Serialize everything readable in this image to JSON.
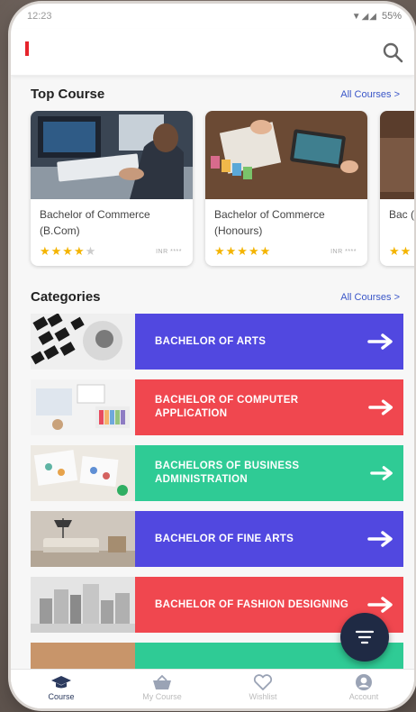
{
  "status_bar": {
    "time": "12:23",
    "battery": "55%"
  },
  "top_course": {
    "title": "Top Course",
    "link": "All Courses >",
    "courses": [
      {
        "name": "Bachelor of Commerce (B.Com)",
        "rating": 4,
        "price": "INR ****"
      },
      {
        "name": "Bachelor of Commerce (Honours)",
        "rating": 5,
        "price": "INR ****"
      },
      {
        "name": "Bac (Ho",
        "rating": 2,
        "price": ""
      }
    ]
  },
  "categories": {
    "title": "Categories",
    "link": "All Courses >",
    "items": [
      {
        "label": "BACHELOR OF ARTS",
        "color": "#5148e0"
      },
      {
        "label": "BACHELOR OF COMPUTER APPLICATION",
        "color": "#f0474f"
      },
      {
        "label": "BACHELORS OF BUSINESS ADMINISTRATION",
        "color": "#2fcb95"
      },
      {
        "label": "BACHELOR OF FINE ARTS",
        "color": "#5148e0"
      },
      {
        "label": "BACHELOR OF FASHION DESIGNING",
        "color": "#f0474f"
      },
      {
        "label": "",
        "color": "#2fcb95"
      }
    ]
  },
  "bottom_nav": {
    "items": [
      {
        "label": "Course",
        "icon": "graduation-cap-icon"
      },
      {
        "label": "My Course",
        "icon": "basket-icon"
      },
      {
        "label": "Wishlist",
        "icon": "heart-icon"
      },
      {
        "label": "Account",
        "icon": "account-icon"
      }
    ]
  },
  "colors": {
    "accent_blue": "#3b57c8",
    "star": "#f4b400",
    "fab": "#1f2a44"
  }
}
